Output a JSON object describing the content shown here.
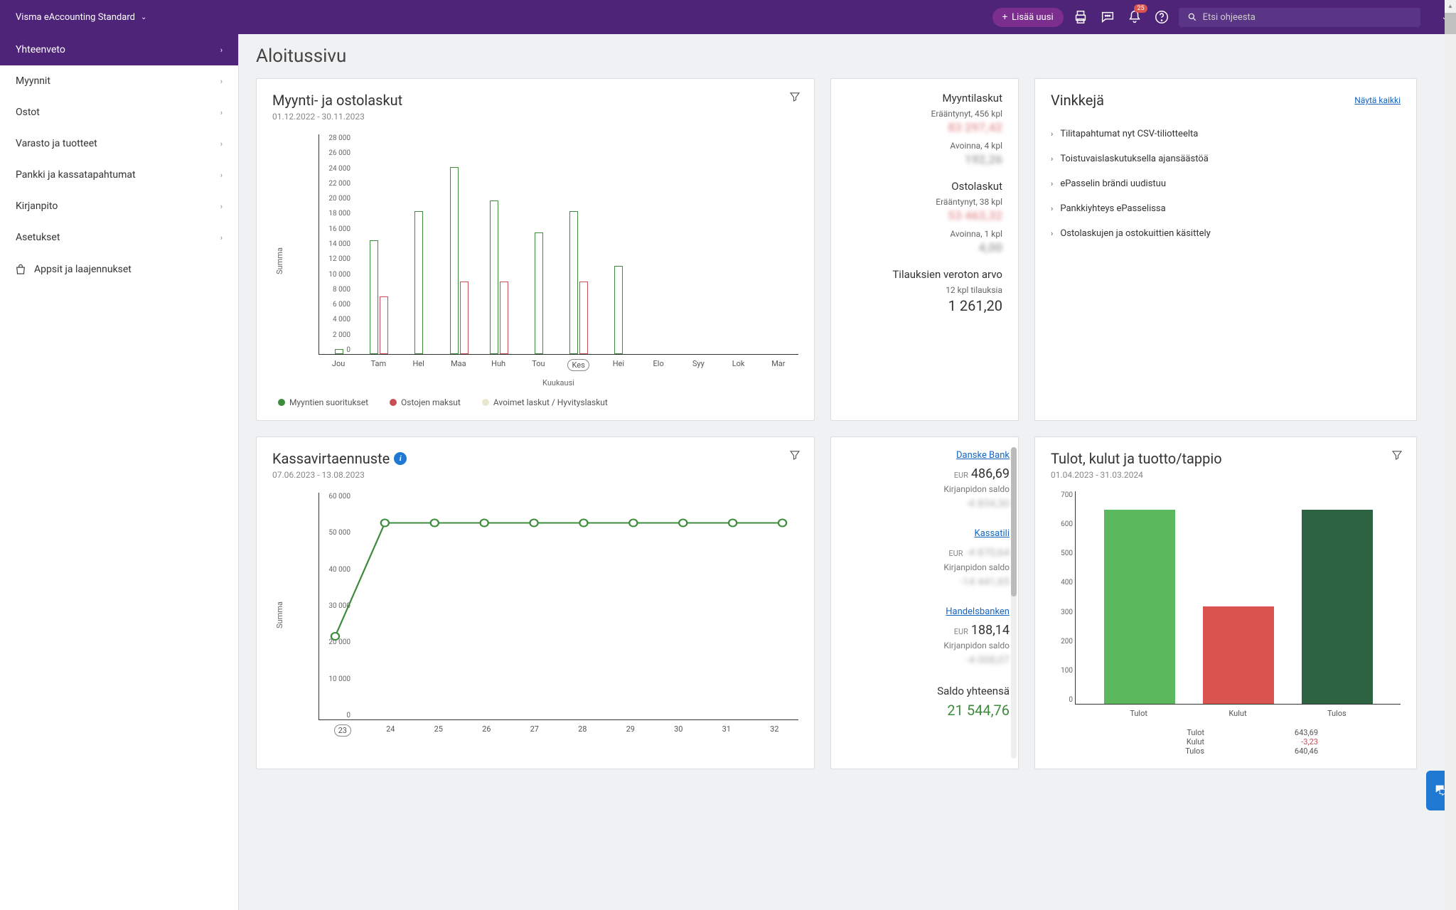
{
  "header": {
    "product": "Visma eAccounting Standard",
    "add_label": "Lisää uusi",
    "notif_count": "25",
    "search_placeholder": "Etsi ohjeesta"
  },
  "sidebar": {
    "items": [
      {
        "label": "Yhteenveto",
        "active": true
      },
      {
        "label": "Myynnit"
      },
      {
        "label": "Ostot"
      },
      {
        "label": "Varasto ja tuotteet"
      },
      {
        "label": "Pankki ja kassatapahtumat"
      },
      {
        "label": "Kirjanpito"
      },
      {
        "label": "Asetukset"
      }
    ],
    "apps_label": "Appsit ja laajennukset"
  },
  "page_title": "Aloitussivu",
  "card1": {
    "title": "Myynti- ja ostolaskut",
    "date_range": "01.12.2022 - 30.11.2023",
    "y_label": "Summa",
    "x_label": "Kuukausi",
    "legend": {
      "sales": "Myyntien suoritukset",
      "purch": "Ostojen maksut",
      "open": "Avoimet laskut / Hyvityslaskut"
    }
  },
  "invoice_stats": {
    "sales_title": "Myyntilaskut",
    "sales_overdue": "Erääntynyt, 456 kpl",
    "sales_overdue_amt": "83 297,42",
    "sales_open": "Avoinna, 4 kpl",
    "sales_open_amt": "192,26",
    "purch_title": "Ostolaskut",
    "purch_overdue": "Erääntynyt, 38 kpl",
    "purch_overdue_amt": "53 463,32",
    "purch_open": "Avoinna, 1 kpl",
    "purch_open_amt": "4,00",
    "orders_title": "Tilauksien veroton arvo",
    "orders_count": "12 kpl tilauksia",
    "orders_value": "1 261,20"
  },
  "tips": {
    "title": "Vinkkejä",
    "show_all": "Näytä kaikki",
    "items": [
      "Tilitapahtumat nyt CSV-tiliotteelta",
      "Toistuvaislaskutuksella ajansäästöä",
      "ePasselin brändi uudistuu",
      "Pankkiyhteys ePasselissa",
      "Ostolaskujen ja ostokuittien käsittely"
    ]
  },
  "card2": {
    "title": "Kassavirtaennuste",
    "date_range": "07.06.2023 - 13.08.2023",
    "y_label": "Summa"
  },
  "banks": {
    "b1_name": "Danske Bank",
    "b1_cur": "EUR",
    "b1_amt": "486,69",
    "b1_sub": "Kirjanpidon saldo",
    "b1_blur": "-4 834,30",
    "b2_name": "Kassatili",
    "b2_cur": "EUR",
    "b2_amt": "-4 870,64",
    "b2_sub": "Kirjanpidon saldo",
    "b2_blur": "-14 441,65",
    "b3_name": "Handelsbanken",
    "b3_cur": "EUR",
    "b3_amt": "188,14",
    "b3_sub": "Kirjanpidon saldo",
    "b3_blur": "-4 008,07",
    "total_label": "Saldo yhteensä",
    "total_amt": "21 544,76"
  },
  "card3": {
    "title": "Tulot, kulut ja tuotto/tappio",
    "date_range": "01.04.2023 - 31.03.2024",
    "labels": {
      "tulot": "Tulot",
      "kulut": "Kulut",
      "tulos": "Tulos"
    },
    "summary": {
      "tulot_label": "Tulot",
      "tulot_val": "643,69",
      "kulut_label": "Kulut",
      "kulut_val": "-3,23",
      "tulos_label": "Tulos",
      "tulos_val": "640,46"
    }
  },
  "chart_data": [
    {
      "id": "sales_purch_bars",
      "type": "bar",
      "title": "Myynti- ja ostolaskut",
      "xlabel": "Kuukausi",
      "ylabel": "Summa",
      "ylim": [
        0,
        28000
      ],
      "y_ticks": [
        "28 000",
        "26 000",
        "24 000",
        "22 000",
        "20 000",
        "18 000",
        "16 000",
        "14 000",
        "12 000",
        "10 000",
        "8 000",
        "6 000",
        "4 000",
        "2 000",
        "0"
      ],
      "categories": [
        "Jou",
        "Tam",
        "Hel",
        "Maa",
        "Huh",
        "Tou",
        "Kes",
        "Hei",
        "Elo",
        "Syy",
        "Lok",
        "Mar"
      ],
      "highlight_category": "Kes",
      "series": [
        {
          "name": "Myyntien suoritukset",
          "values": [
            600,
            14500,
            18200,
            23800,
            19600,
            15500,
            18200,
            11200,
            0,
            0,
            0,
            0
          ]
        },
        {
          "name": "Ostojen maksut",
          "values": [
            0,
            7300,
            0,
            9200,
            9200,
            0,
            9200,
            0,
            0,
            0,
            0,
            0
          ]
        }
      ]
    },
    {
      "id": "cashflow_line",
      "type": "line",
      "title": "Kassavirtaennuste",
      "ylabel": "Summa",
      "ylim": [
        0,
        60000
      ],
      "y_ticks": [
        "60 000",
        "50 000",
        "40 000",
        "30 000",
        "20 000",
        "10 000",
        "0"
      ],
      "x": [
        "23",
        "24",
        "25",
        "26",
        "27",
        "28",
        "29",
        "30",
        "31",
        "32"
      ],
      "highlight_x": "23",
      "values": [
        22000,
        52000,
        52000,
        52000,
        52000,
        52000,
        52000,
        52000,
        52000,
        52000
      ]
    },
    {
      "id": "pl_bars",
      "type": "bar",
      "title": "Tulot, kulut ja tuotto/tappio",
      "ylim": [
        0,
        700
      ],
      "y_ticks": [
        "700",
        "600",
        "500",
        "400",
        "300",
        "200",
        "100",
        "0"
      ],
      "categories": [
        "Tulot",
        "Kulut",
        "Tulos"
      ],
      "values": [
        640,
        320,
        640
      ]
    }
  ]
}
